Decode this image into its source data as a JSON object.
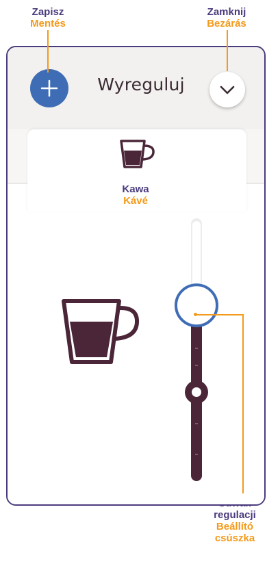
{
  "callouts": {
    "save": {
      "pl": "Zapisz",
      "hu": "Mentés"
    },
    "close": {
      "pl": "Zamknij",
      "hu": "Bezárás"
    },
    "slider": {
      "pl1": "Suwak",
      "pl2": "regulacji",
      "hu1": "Beállító",
      "hu2": "csúszka"
    }
  },
  "header": {
    "title": "Wyreguluj"
  },
  "tab": {
    "label_pl": "Kawa",
    "label_hu": "Kávé",
    "icon": "coffee-cup-icon"
  },
  "slider": {
    "level_percent": 68
  },
  "icons": {
    "save": "plus-icon",
    "close": "chevron-down-icon",
    "cup": "coffee-cup-icon"
  },
  "colors": {
    "accent_blue": "#3f6db5",
    "dark_plum": "#4a2638",
    "callout_purple": "#4b3b7d",
    "callout_orange": "#f39a1a"
  }
}
